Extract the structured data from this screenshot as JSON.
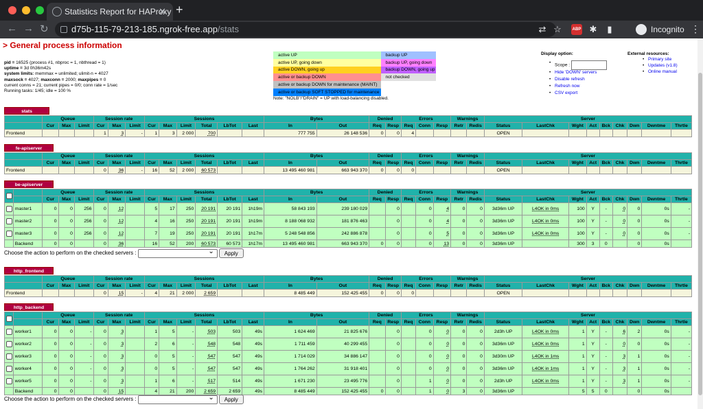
{
  "browser": {
    "tab_title": "Statistics Report for HAProxy",
    "tab_close": "✕",
    "new_tab": "+",
    "url_host": "d75b-115-79-213-185.ngrok-free.app",
    "url_path": "/stats",
    "abp_label": "ABP",
    "profile_label": "Incognito",
    "traffic_colors": [
      "#ff5f57",
      "#febc2e",
      "#28c840"
    ]
  },
  "page": {
    "heading": "> General process information",
    "process": {
      "line1_label": "pid = ",
      "line1_value": "16525 (process #1, nbproc = 1, nbthread = 1)",
      "line2_label": "uptime = ",
      "line2_value": "3d 0h36m42s",
      "line3_label": "system limits:",
      "line3_value": " memmax = unlimited; ulimit-n = 4027",
      "line4_label": "maxsock = ",
      "line4_value": "4027; ",
      "line4_label2": "maxconn = ",
      "line4_value2": "2000; ",
      "line4_label3": "maxpipes = ",
      "line4_value3": "0",
      "line5": "current conns = 21; current pipes = 0/0; conn rate = 1/sec",
      "line6": "Running tasks: 1/45; idle = 100 %"
    },
    "legend": {
      "left": [
        {
          "label": "active UP",
          "color": "#c0ffc0"
        },
        {
          "label": "active UP, going down",
          "color": "#ffffa0"
        },
        {
          "label": "active DOWN, going up",
          "color": "#ffd020"
        },
        {
          "label": "active or backup DOWN",
          "color": "#ff9090"
        },
        {
          "label": "active or backup DOWN for maintenance (MAINT)",
          "color": "#c0c0c0"
        },
        {
          "label": "active or backup SOFT STOPPED for maintenance",
          "color": "#0080ff"
        }
      ],
      "right": [
        {
          "label": "backup UP",
          "color": "#a0c0ff"
        },
        {
          "label": "backup UP, going down",
          "color": "#ff80ff"
        },
        {
          "label": "backup DOWN, going up",
          "color": "#c060ff"
        },
        {
          "label": "not checked",
          "color": "#e0e0e0"
        }
      ],
      "note": "Note: \"NOLB\"/\"DRAIN\" = UP with load-balancing disabled."
    },
    "display": {
      "heading": "Display option:",
      "scope_label": "Scope :",
      "links": [
        "Hide 'DOWN' servers",
        "Disable refresh",
        "Refresh now",
        "CSV export"
      ]
    },
    "external": {
      "heading": "External resources:",
      "links": [
        "Primary site",
        "Updates (v1.8)",
        "Online manual"
      ]
    },
    "action": {
      "label": "Choose the action to perform on the checked servers : ",
      "button": "Apply"
    },
    "headers": {
      "queue": "Queue",
      "session_rate": "Session rate",
      "sessions": "Sessions",
      "bytes": "Bytes",
      "denied": "Denied",
      "errors": "Errors",
      "warnings": "Warnings",
      "server": "Server",
      "cur": "Cur",
      "max": "Max",
      "limit": "Limit",
      "total": "Total",
      "lbtot": "LbTot",
      "last": "Last",
      "in": "In",
      "out": "Out",
      "req": "Req",
      "resp": "Resp",
      "conn": "Conn",
      "retr": "Retr",
      "redis": "Redis",
      "status": "Status",
      "lastchk": "LastChk",
      "wght": "Wght",
      "act": "Act",
      "bck": "Bck",
      "chk": "Chk",
      "dwn": "Dwn",
      "dwntme": "Dwntme",
      "thrtle": "Thrtle"
    },
    "proxies": [
      {
        "name": "stats",
        "frontend": [
          "Frontend",
          "",
          "",
          "",
          "1",
          "3",
          "-",
          "1",
          "3",
          "2 000",
          "700",
          "",
          "",
          "777 755",
          "26 148 536",
          "0",
          "0",
          "4",
          "",
          "",
          "",
          "",
          "OPEN",
          "",
          "",
          "",
          "",
          "",
          "",
          "",
          ""
        ]
      },
      {
        "name": "fe-apiserver",
        "frontend": [
          "Frontend",
          "",
          "",
          "",
          "0",
          "36",
          "-",
          "16",
          "52",
          "2 000",
          "60 573",
          "",
          "",
          "13 495 460 981",
          "663 943 370",
          "0",
          "0",
          "0",
          "",
          "",
          "",
          "",
          "OPEN",
          "",
          "",
          "",
          "",
          "",
          "",
          "",
          ""
        ]
      },
      {
        "name": "be-apiserver",
        "servers": [
          [
            "master1",
            "0",
            "0",
            "256",
            "0",
            "12",
            "",
            "5",
            "17",
            "250",
            "20 191",
            "20 191",
            "1h19m",
            "58 843 193",
            "239 180 029",
            "",
            "0",
            "",
            "0",
            "4",
            "0",
            "0",
            "3d36m UP",
            "L4OK in 0ms",
            "100",
            "Y",
            "-",
            "0",
            "0",
            "0s",
            "-"
          ],
          [
            "master2",
            "0",
            "0",
            "256",
            "0",
            "12",
            "",
            "4",
            "16",
            "250",
            "20 191",
            "20 191",
            "1h19m",
            "8 188 068 932",
            "181 876 463",
            "",
            "0",
            "",
            "0",
            "4",
            "0",
            "0",
            "3d36m UP",
            "L4OK in 0ms",
            "100",
            "Y",
            "-",
            "0",
            "0",
            "0s",
            "-"
          ],
          [
            "master3",
            "0",
            "0",
            "256",
            "0",
            "12",
            "",
            "7",
            "19",
            "250",
            "20 191",
            "20 191",
            "1h17m",
            "5 248 548 856",
            "242 886 878",
            "",
            "0",
            "",
            "0",
            "5",
            "0",
            "0",
            "3d36m UP",
            "L4OK in 0ms",
            "100",
            "Y",
            "-",
            "0",
            "0",
            "0s",
            "-"
          ]
        ],
        "backend": [
          "Backend",
          "0",
          "0",
          "",
          "0",
          "36",
          "",
          "16",
          "52",
          "200",
          "60 573",
          "60 573",
          "1h17m",
          "13 495 460 981",
          "663 943 370",
          "0",
          "0",
          "",
          "0",
          "13",
          "0",
          "0",
          "3d36m UP",
          "",
          "300",
          "3",
          "0",
          "",
          "0",
          "0s",
          ""
        ]
      },
      {
        "name": "http_frontend",
        "frontend": [
          "Frontend",
          "",
          "",
          "",
          "0",
          "15",
          "-",
          "4",
          "21",
          "2 000",
          "2 659",
          "",
          "",
          "8 485 449",
          "152 425 455",
          "0",
          "0",
          "0",
          "",
          "",
          "",
          "",
          "OPEN",
          "",
          "",
          "",
          "",
          "",
          "",
          "",
          ""
        ]
      },
      {
        "name": "http_backend",
        "servers": [
          [
            "worker1",
            "0",
            "0",
            "-",
            "0",
            "3",
            "",
            "1",
            "5",
            "-",
            "503",
            "503",
            "49s",
            "1 624 469",
            "21 825 676",
            "",
            "0",
            "",
            "0",
            "0",
            "0",
            "0",
            "2d3h UP",
            "L4OK in 0ms",
            "1",
            "Y",
            "-",
            "6",
            "2",
            "0s",
            "-"
          ],
          [
            "worker2",
            "0",
            "0",
            "-",
            "0",
            "3",
            "",
            "2",
            "6",
            "-",
            "548",
            "548",
            "49s",
            "1 711 459",
            "40 299 455",
            "",
            "0",
            "",
            "0",
            "0",
            "0",
            "0",
            "3d36m UP",
            "L4OK in 0ms",
            "1",
            "Y",
            "-",
            "0",
            "0",
            "0s",
            "-"
          ],
          [
            "worker3",
            "0",
            "0",
            "-",
            "0",
            "3",
            "",
            "0",
            "5",
            "-",
            "547",
            "547",
            "49s",
            "1 714 029",
            "34 886 147",
            "",
            "0",
            "",
            "0",
            "0",
            "0",
            "0",
            "3d30m UP",
            "L4OK in 1ms",
            "1",
            "Y",
            "-",
            "3",
            "1",
            "0s",
            "-"
          ],
          [
            "worker4",
            "0",
            "0",
            "-",
            "0",
            "3",
            "",
            "0",
            "5",
            "-",
            "547",
            "547",
            "49s",
            "1 764 262",
            "31 918 401",
            "",
            "0",
            "",
            "0",
            "0",
            "0",
            "0",
            "3d36m UP",
            "L4OK in 1ms",
            "1",
            "Y",
            "-",
            "3",
            "1",
            "0s",
            "-"
          ],
          [
            "worker5",
            "0",
            "0",
            "-",
            "0",
            "3",
            "",
            "1",
            "6",
            "-",
            "517",
            "514",
            "49s",
            "1 671 230",
            "23 495 776",
            "",
            "0",
            "",
            "1",
            "0",
            "0",
            "0",
            "2d3h UP",
            "L4OK in 0ms",
            "1",
            "Y",
            "-",
            "3",
            "1",
            "0s",
            "-"
          ]
        ],
        "backend": [
          "Backend",
          "0",
          "0",
          "",
          "0",
          "15",
          "",
          "4",
          "21",
          "200",
          "2 659",
          "2 659",
          "49s",
          "8 485 449",
          "152 425 455",
          "0",
          "0",
          "",
          "1",
          "0",
          "3",
          "0",
          "3d36m UP",
          "",
          "5",
          "5",
          "0",
          "",
          "0",
          "0s",
          ""
        ]
      }
    ]
  }
}
